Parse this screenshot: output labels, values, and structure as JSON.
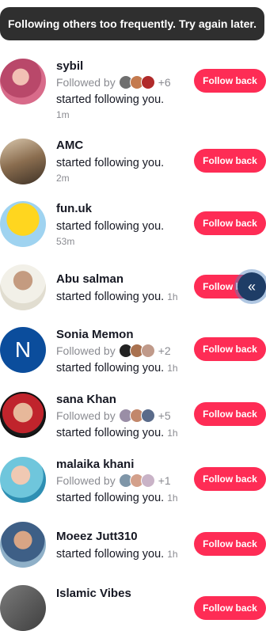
{
  "toast": {
    "text": "Following others too frequently. Try again later."
  },
  "follow_label": "Follow back",
  "items": [
    {
      "name": "sybil",
      "followed_by_label": "Followed by",
      "followed_count": "+6",
      "message": "started following you.",
      "time": "1m"
    },
    {
      "name": "AMC",
      "message": "started following you.",
      "time": "2m"
    },
    {
      "name": "fun.uk",
      "message": "started following you.",
      "time": "53m"
    },
    {
      "name": "Abu salman",
      "message": "started following you.",
      "time": "1h"
    },
    {
      "name": "Sonia Memon",
      "avatar_initial": "N",
      "followed_by_label": "Followed by",
      "followed_count": "+2",
      "message": "started following you.",
      "time": "1h"
    },
    {
      "name": "sana Khan",
      "followed_by_label": "Followed by",
      "followed_count": "+5",
      "message": "started following you.",
      "time": "1h"
    },
    {
      "name": "malaika khani",
      "followed_by_label": "Followed by",
      "followed_count": "+1",
      "message": "started following you.",
      "time": "1h"
    },
    {
      "name": "Moeez Jutt310",
      "message": "started following you.",
      "time": "1h"
    },
    {
      "name": "Islamic Vibes"
    }
  ],
  "floating_icon": "double-chevron-left-icon",
  "colors": {
    "accent": "#fe2c55",
    "toast_bg": "#2f2f2f",
    "secondary_text": "#8a8b91",
    "float_btn": "#1e3d66"
  }
}
